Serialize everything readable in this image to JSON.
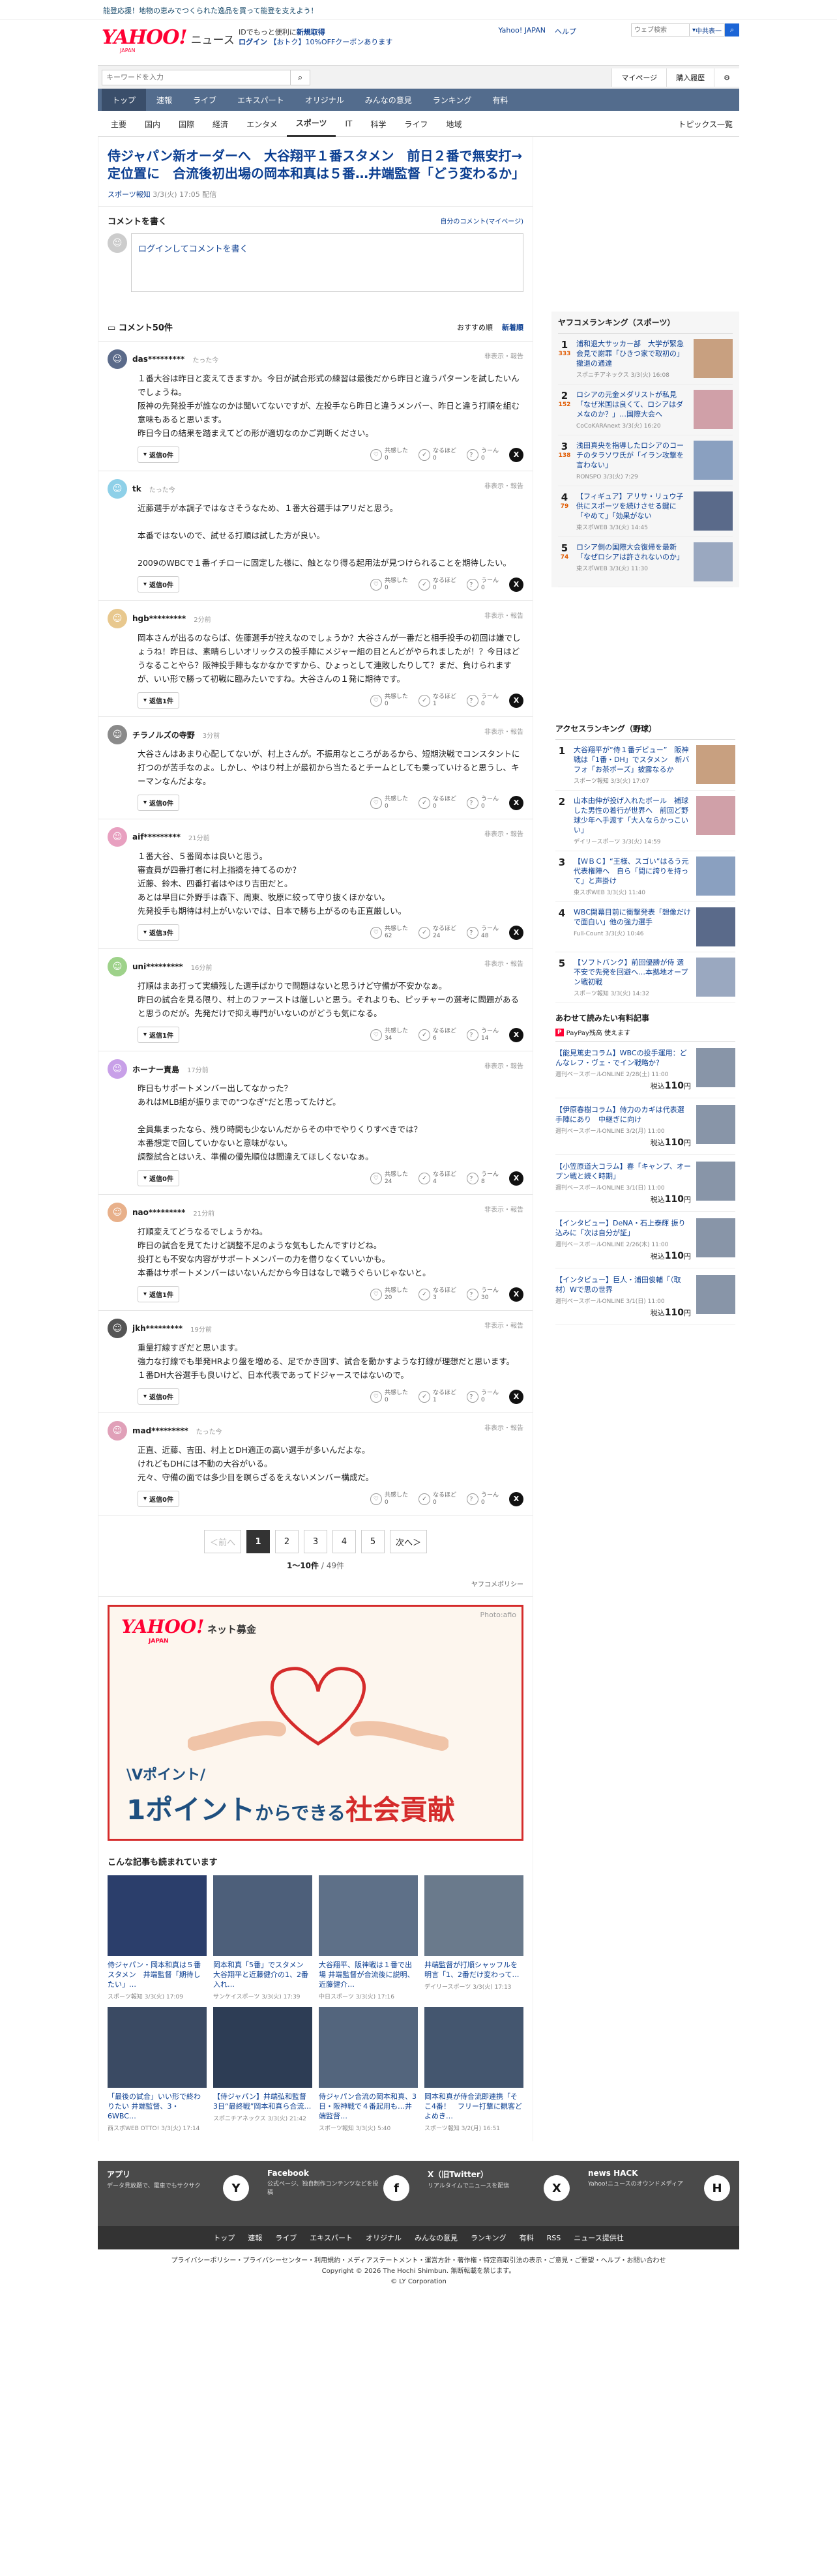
{
  "promo": {
    "text": "能登応援！地物の恵みでつくられた逸品を買って能登を支えよう！"
  },
  "header": {
    "logo": "YAHOO!",
    "logo_sub": "JAPAN",
    "logo_news": "ニュース",
    "login_line1_pre": "IDでもっと便利に",
    "login_line1_link": "新規取得",
    "login_line2_link": "ログイン",
    "coupon": "【おトク】10%OFFクーポンあります",
    "top_links": [
      "Yahoo! JAPAN",
      "ヘルプ"
    ],
    "web_search_placeholder": "ウェブ検索",
    "web_search_option": "中共表一"
  },
  "search": {
    "placeholder": "キーワードを入力",
    "mypage": "マイページ",
    "purchase": "購入履歴"
  },
  "cat_tabs": [
    "トップ",
    "速報",
    "ライブ",
    "エキスパート",
    "オリジナル",
    "みんなの意見",
    "ランキング",
    "有料"
  ],
  "sub_nav": [
    "主要",
    "国内",
    "国際",
    "経済",
    "エンタメ",
    "スポーツ",
    "IT",
    "科学",
    "ライフ",
    "地域"
  ],
  "topics_link": "トピックス一覧",
  "article": {
    "title": "侍ジャパン新オーダーへ　大谷翔平１番スタメン　前日２番で無安打→定位置に　合流後初出場の岡本和真は５番…井端監督「どう変わるか」",
    "source": "スポーツ報知",
    "date": "3/3(火) 17:05 配信"
  },
  "comment_write": {
    "title": "コメントを書く",
    "my": "自分のコメント(マイページ)",
    "placeholder": "ログインしてコメントを書く"
  },
  "comment_list": {
    "title": "コメント50件",
    "sort_recommended": "おすすめ順",
    "sort_new": "新着順"
  },
  "comments": [
    {
      "user": "das*********",
      "time": "たった今",
      "body": "１番大谷は昨日と変えてきますか。今日が試合形式の練習は最後だから昨日と違うパターンを試したいんでしょうね。\n阪神の先発投手が誰なのかは聞いてないですが、左投手なら昨日と違うメンバー、昨日と違う打順を組む意味もあると思います。\n昨日今日の結果を踏まえてどの形が適切なのかご判断ください。",
      "reply": "返信0件",
      "r1": "0",
      "r2": "0",
      "r3": "0"
    },
    {
      "user": "tk",
      "time": "たった今",
      "body": "近藤選手が本調子ではなさそうなため、１番大谷選手はアリだと思う。\n\n本番ではないので、試せる打順は試した方が良い。\n\n2009のWBCで１番イチローに固定した様に、触となり得る起用法が見つけられることを期待したい。",
      "reply": "返信0件",
      "r1": "0",
      "r2": "0",
      "r3": "0"
    },
    {
      "user": "hgb*********",
      "time": "2分前",
      "body": "岡本さんが出るのならば、佐藤選手が控えなのでしょうか？大谷さんが一番だと相手投手の初回は嫌でしょうね！昨日は、素晴らしいオリックスの投手陣にメジャー組の目とんどがやられましたが！？今日はどうなることやら？阪神投手陣もなかなかですから、ひょっとして連敗したりして？まだ、負けられますが、いい形で勝って初戦に臨みたいですね。大谷さんの１発に期待です。",
      "reply": "返信1件",
      "r1": "0",
      "r2": "1",
      "r3": "0"
    },
    {
      "user": "チラノルズの寺野",
      "time": "3分前",
      "body": "大谷さんはあまり心配してないが、村上さんが。不振用なところがあるから、短期決戦でコンスタントに打つのが苦手なのよ。しかし、やはり村上が最初から当たるとチームとしても乗っていけると思うし、キーマンなんだよな。",
      "reply": "返信0件",
      "r1": "0",
      "r2": "0",
      "r3": "0"
    },
    {
      "user": "aif*********",
      "time": "21分前",
      "body": "１番大谷、５番岡本は良いと思う。\n審査員が四番打者に村上指摘を持てるのか？\n近藤、鈴木、四番打者はやはり吉田だと。\nあとは早目に外野手は森下、周東、牧原に絞って守り抜くほかない。\n先発投手も期待は村上がいないでは、日本で勝ち上がるのも正直厳しい。",
      "reply": "返信3件",
      "r1": "62",
      "r2": "24",
      "r3": "48"
    },
    {
      "user": "uni*********",
      "time": "16分前",
      "body": "打順はまあ打って実績残した選手ばかりで問題はないと思うけど守備が不安かなぁ。\n昨日の試合を見る限り、村上のファーストは厳しいと思う。それよりも、ピッチャーの選考に問題があると思うのだが。先発だけで抑え専門がいないのがどうも気になる。",
      "reply": "返信1件",
      "r1": "34",
      "r2": "6",
      "r3": "14"
    },
    {
      "user": "ホーナー責島",
      "time": "17分前",
      "body": "昨日もサポートメンバー出してなかった？\nあれはMLB組が振りまでの\"つなぎ\"だと思ってたけど。\n\n全員集まったなら、残り時間も少ないんだからその中でやりくりすべきでは？\n本番想定で回していかないと意味がない。\n調整試合とはいえ、準備の優先順位は間違えてほしくないなぁ。",
      "reply": "返信0件",
      "r1": "24",
      "r2": "4",
      "r3": "8"
    },
    {
      "user": "nao*********",
      "time": "21分前",
      "body": "打順変えてどうなるでしょうかね。\n昨日の試合を見てたけど調整不足のような気もしたんですけどね。\n投打とも不安な内容がサポートメンバーの力を借りなくていいかも。\n本番はサポートメンバーはいないんだから今日はなしで戦うぐらいじゃないと。",
      "reply": "返信1件",
      "r1": "20",
      "r2": "3",
      "r3": "30"
    },
    {
      "user": "jkh*********",
      "time": "19分前",
      "body": "重量打線すぎだと思います。\n強力な打線でも単発HRより盤を増める、足でかき回す、試合を動かすような打線が理想だと思います。\n１番DH大谷選手も良いけど、日本代表であってドジャースではないので。",
      "reply": "返信0件",
      "r1": "0",
      "r2": "1",
      "r3": "0"
    },
    {
      "user": "mad*********",
      "time": "たった今",
      "body": "正直、近藤、吉田、村上とDH適正の高い選手が多いんだよな。\nけれどもDHには不動の大谷がいる。\n元々、守備の面では多少目を瞑らざるをえないメンバー構成だ。",
      "reply": "返信0件",
      "r1": "0",
      "r2": "0",
      "r3": "0"
    }
  ],
  "reactions": {
    "a": "共感した",
    "b": "なるほど",
    "c": "うーん"
  },
  "report": "非表示・報告",
  "pager": {
    "prev": "＜前へ",
    "next": "次へ＞",
    "pages": [
      "1",
      "2",
      "3",
      "4",
      "5"
    ],
    "count": "1〜10件",
    "total": " / 49件"
  },
  "policy": "ヤフコメポリシー",
  "ad": {
    "logo": "YAHOO!",
    "logo_sub": "JAPAN",
    "name": "ネット募金",
    "photo": "Photo:afio",
    "copy1": "\\Vポイント/",
    "copy2a": "1ポイント",
    "copy2b": "からできる",
    "copy2c": "社会貢献"
  },
  "reco": {
    "title": "こんな記事も読まれています",
    "items": [
      {
        "t": "侍ジャパン・岡本和真は５番スタメン　井端監督「期待したい」…",
        "s": "スポーツ報知 3/3(火) 17:09"
      },
      {
        "t": "岡本和真「5番」でスタメン　大谷翔平と近藤健介の1、2番入れ…",
        "s": "サンケイスポーツ 3/3(火) 17:39"
      },
      {
        "t": "大谷翔平、阪神戦は１番で出場 井端監督が合流後に説明、近藤健介…",
        "s": "中日スポーツ 3/3(火) 17:16"
      },
      {
        "t": "井端監督が打順シャッフルを明言「1、2番だけ変わって…",
        "s": "デイリースポーツ 3/3(火) 17:13"
      },
      {
        "t": "「最後の試合」いい形で終わりたい 井端監督、3・6WBC…",
        "s": "西スポWEB OTTO! 3/3(火) 17:14"
      },
      {
        "t": "【侍ジャパン】井端弘和監督　3日“最終戦”岡本和真ら合流…",
        "s": "スポニチアネックス 3/3(火) 21:42"
      },
      {
        "t": "侍ジャパン合流の岡本和真、3日・阪神戦で４番起用も…井端監督…",
        "s": "スポーツ報知 3/3(火) 5:40"
      },
      {
        "t": "岡本和真が侍合流即連携「そこ4番！　フリー打撃に観客どよめき…",
        "s": "スポーツ報知 3/2(月) 16:51"
      }
    ]
  },
  "ranking_sports": {
    "title": "ヤフコメランキング（スポーツ）",
    "items": [
      {
        "n": "1",
        "c": "333",
        "t": "浦和退大サッカー部　大学が緊急会見で謝罪「ひきつ家で取初の」撤退の通達",
        "s": "スポニチアネックス 3/3(火) 16:08"
      },
      {
        "n": "2",
        "c": "152",
        "t": "ロシアの元金メダリストが私見「なぜ米国は良くて、ロシアはダメなのか？」…国際大会へ",
        "s": "CoCoKARAnext 3/3(火) 16:20"
      },
      {
        "n": "3",
        "c": "138",
        "t": "浅田真央を指導したロシアのコーチのタラソワ氏が「イラン攻撃を言わない」",
        "s": "RONSPO 3/3(火) 7:29"
      },
      {
        "n": "4",
        "c": "79",
        "t": "【フィギュア】アリサ・リュウ子供にスポーツを続けさせる鍵に「やめて」「効果がない",
        "s": "東スポWEB 3/3(火) 14:45"
      },
      {
        "n": "5",
        "c": "74",
        "t": "ロシア側の国際大会復帰を最新「なぜロシアは許されないのか」",
        "s": "東スポWEB 3/3(火) 11:30"
      }
    ]
  },
  "ranking_access": {
    "title": "アクセスランキング（野球）",
    "items": [
      {
        "n": "1",
        "t": "大谷翔平が“侍１番デビュー”　阪神戦は「1番・DH」でスタメン　新バフォ「お茶ポーズ」披露なるか",
        "s": "スポーツ報知 3/3(火) 17:07"
      },
      {
        "n": "2",
        "t": "山本由伸が投げ入れたボール　補球した男性の着行が世界へ　前回ど野球少年へ手渡す「大人ならかっこいい」",
        "s": "デイリースポーツ 3/3(火) 14:59"
      },
      {
        "n": "3",
        "t": "【ＷＢＣ】“王様、スゴい”はるう元代表権陣へ　自ら「間に誇りを持って」と声掛け",
        "s": "東スポWEB 3/3(火) 11:40"
      },
      {
        "n": "4",
        "t": "WBC開幕目前に衝撃発表「想像だけで面白い」他の強力選手",
        "s": "Full-Count 3/3(火) 10:46"
      },
      {
        "n": "5",
        "t": "【ソフトバンク】前回優勝が侍 選不安で先発を回避へ…本拠地オープン戦初戦",
        "s": "スポーツ報知 3/3(火) 14:32"
      }
    ]
  },
  "shop": {
    "title": "あわせて読みたい有料記事",
    "pp": "PayPay残高",
    "pp_text": "PayPay残高 使えます",
    "price_label": "税込",
    "items": [
      {
        "t": "【能見篤史コラム】WBCの投手運用：どんなレフ・ヴェ・でイン戦略か？",
        "s": "週刊ベースボールONLINE 2/28(土) 11:00",
        "p": "110"
      },
      {
        "t": "【伊原春樹コラム】侍力のカギは代表選手陣にあり　中継ぎに向け",
        "s": "週刊ベースボールONLINE 3/2(月) 11:00",
        "p": "110"
      },
      {
        "t": "【小笠原道大コラム】春「キャンプ、オープン戦と続く時期」",
        "s": "週刊ベースボールONLINE 3/1(日) 11:00",
        "p": "110"
      },
      {
        "t": "【インタビュー】DeNA・石上泰輝 振り込みに「次は自分が証」",
        "s": "週刊ベースボールONLINE 2/26(木) 11:00",
        "p": "110"
      },
      {
        "t": "【インタビュー】巨人・浦田俊輔「（取材）Wで思の世界",
        "s": "週刊ベースボールONLINE 3/1(日) 11:00",
        "p": "110"
      }
    ]
  },
  "footer": {
    "boxes": [
      {
        "t": "アプリ",
        "d": "データ見放題で、電車でもサクサク",
        "i": "Y"
      },
      {
        "t": "Facebook",
        "d": "公式ページ、独自制作コンテンツなどを投稿",
        "i": "f"
      },
      {
        "t": "X（旧Twitter）",
        "d": "リアルタイムでニュースを配信",
        "i": "X"
      },
      {
        "t": "news HACK",
        "d": "Yahoo!ニュースのオウンドメディア",
        "i": "H"
      }
    ],
    "nav": [
      "トップ",
      "速報",
      "ライブ",
      "エキスパート",
      "オリジナル",
      "みんなの意見",
      "ランキング",
      "有料",
      "RSS",
      "ニュース提供社"
    ],
    "legal": "プライバシーポリシー・プライバシーセンター・利用規約・メディアステートメント・運営方針・著作権・特定商取引法の表示・ご意見・ご要望・ヘルプ・お問い合わせ",
    "copy1": "Copyright © 2026 The Hochi Shimbun. 無断転載を禁じます。",
    "copy2": "© LY Corporation"
  }
}
